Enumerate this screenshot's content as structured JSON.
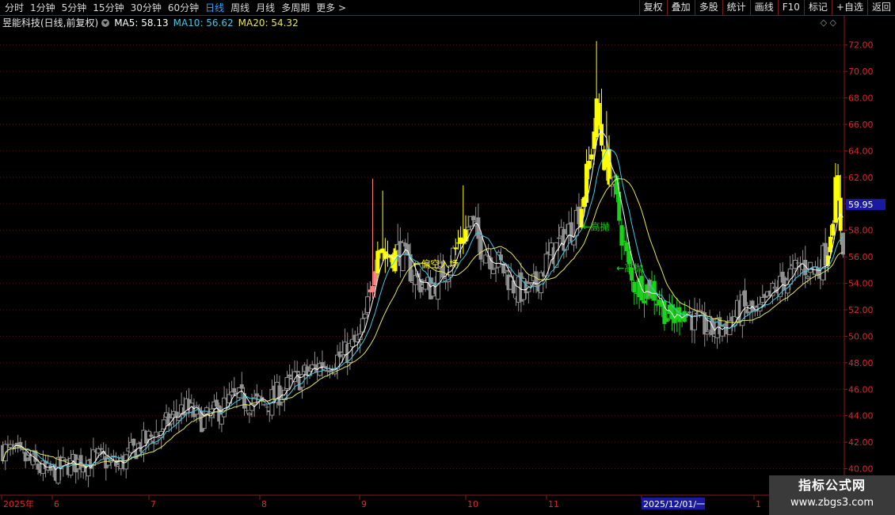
{
  "toolbar": {
    "periods": [
      "分时",
      "1分钟",
      "5分钟",
      "15分钟",
      "30分钟",
      "60分钟",
      "日线",
      "周线",
      "月线",
      "多周期",
      "更多 >"
    ],
    "active_period": "日线",
    "tools": [
      "复权",
      "叠加",
      "多股",
      "统计",
      "画线",
      "F10",
      "标记",
      "+自选",
      "返回"
    ]
  },
  "info": {
    "stock": "昱能科技(日线,前复权)",
    "ma5_label": "MA5: 58.13",
    "ma10_label": "MA10: 56.62",
    "ma20_label": "MA20: 54.32",
    "top_icons": "◇ ◇"
  },
  "colors": {
    "up": "#ffff00",
    "down": "#909090",
    "green": "#19d219",
    "red_up": "#ff8080",
    "ma5": "#ffffff",
    "ma10": "#3fc8e6",
    "ma20": "#e6e65a",
    "axis": "#8a1c1c",
    "label": "#dc2828",
    "price_box": "#1a1aa0"
  },
  "watermark": {
    "title": "指标公式网",
    "url": "www.zbgs3.com"
  },
  "chart_data": {
    "type": "candlestick",
    "y_ticks": [
      "72.00",
      "70.00",
      "68.00",
      "66.00",
      "64.00",
      "62.00",
      "60.00",
      "58.00",
      "56.00",
      "54.00",
      "52.00",
      "50.00",
      "48.00",
      "46.00",
      "44.00",
      "42.00",
      "40.00"
    ],
    "ylim": [
      38.0,
      73.0
    ],
    "current_price": "59.95",
    "x_labels": [
      "2025年",
      "6",
      "7",
      "8",
      "9",
      "10",
      "11",
      "2025/12/01/一",
      "1"
    ],
    "annotations": [
      {
        "text": "←偏空入场",
        "at": [
          0.489,
          55.2
        ]
      },
      {
        "text": "←高抛",
        "at": [
          0.69,
          58.0
        ]
      },
      {
        "text": "←高抛",
        "at": [
          0.73,
          54.9
        ]
      }
    ],
    "anchors": [
      [
        0,
        41.5
      ],
      [
        10,
        40.6
      ],
      [
        18,
        39.6
      ],
      [
        26,
        40.3
      ],
      [
        38,
        40.8
      ],
      [
        46,
        40.2
      ],
      [
        54,
        41.7
      ],
      [
        62,
        42.8
      ],
      [
        72,
        44.6
      ],
      [
        80,
        43.6
      ],
      [
        92,
        45.3
      ],
      [
        104,
        44.8
      ],
      [
        116,
        46.6
      ],
      [
        126,
        47.8
      ],
      [
        136,
        48.6
      ],
      [
        142,
        49.8
      ],
      [
        146,
        53.0
      ],
      [
        149,
        57.4
      ],
      [
        152,
        56.0
      ],
      [
        158,
        56.4
      ],
      [
        164,
        54.3
      ],
      [
        170,
        53.6
      ],
      [
        176,
        55.2
      ],
      [
        182,
        57.3
      ],
      [
        186,
        58.6
      ],
      [
        190,
        56.8
      ],
      [
        198,
        55.3
      ],
      [
        204,
        53.5
      ],
      [
        210,
        53.3
      ],
      [
        216,
        55.6
      ],
      [
        222,
        57.2
      ],
      [
        226,
        58.2
      ],
      [
        230,
        60.0
      ],
      [
        233,
        63.0
      ],
      [
        236,
        67.0
      ],
      [
        239,
        63.5
      ],
      [
        242,
        62.0
      ],
      [
        246,
        57.8
      ],
      [
        250,
        54.0
      ],
      [
        254,
        53.8
      ],
      [
        258,
        53.6
      ],
      [
        262,
        52.3
      ],
      [
        266,
        51.1
      ],
      [
        270,
        52.2
      ],
      [
        276,
        51.0
      ],
      [
        282,
        50.4
      ],
      [
        288,
        50.9
      ],
      [
        294,
        52.1
      ],
      [
        300,
        51.5
      ],
      [
        306,
        53.2
      ],
      [
        312,
        54.5
      ],
      [
        318,
        55.3
      ],
      [
        324,
        55.0
      ],
      [
        328,
        56.8
      ],
      [
        331,
        61.0
      ],
      [
        334,
        57.0
      ]
    ],
    "colored_spans": [
      {
        "from": 146,
        "to": 148,
        "color": "red_up"
      },
      {
        "from": 149,
        "to": 156,
        "color": "up"
      },
      {
        "from": 180,
        "to": 184,
        "color": "up"
      },
      {
        "from": 230,
        "to": 241,
        "color": "up"
      },
      {
        "from": 244,
        "to": 256,
        "color": "green"
      },
      {
        "from": 258,
        "to": 272,
        "color": "green"
      },
      {
        "from": 328,
        "to": 333,
        "color": "up"
      }
    ]
  }
}
